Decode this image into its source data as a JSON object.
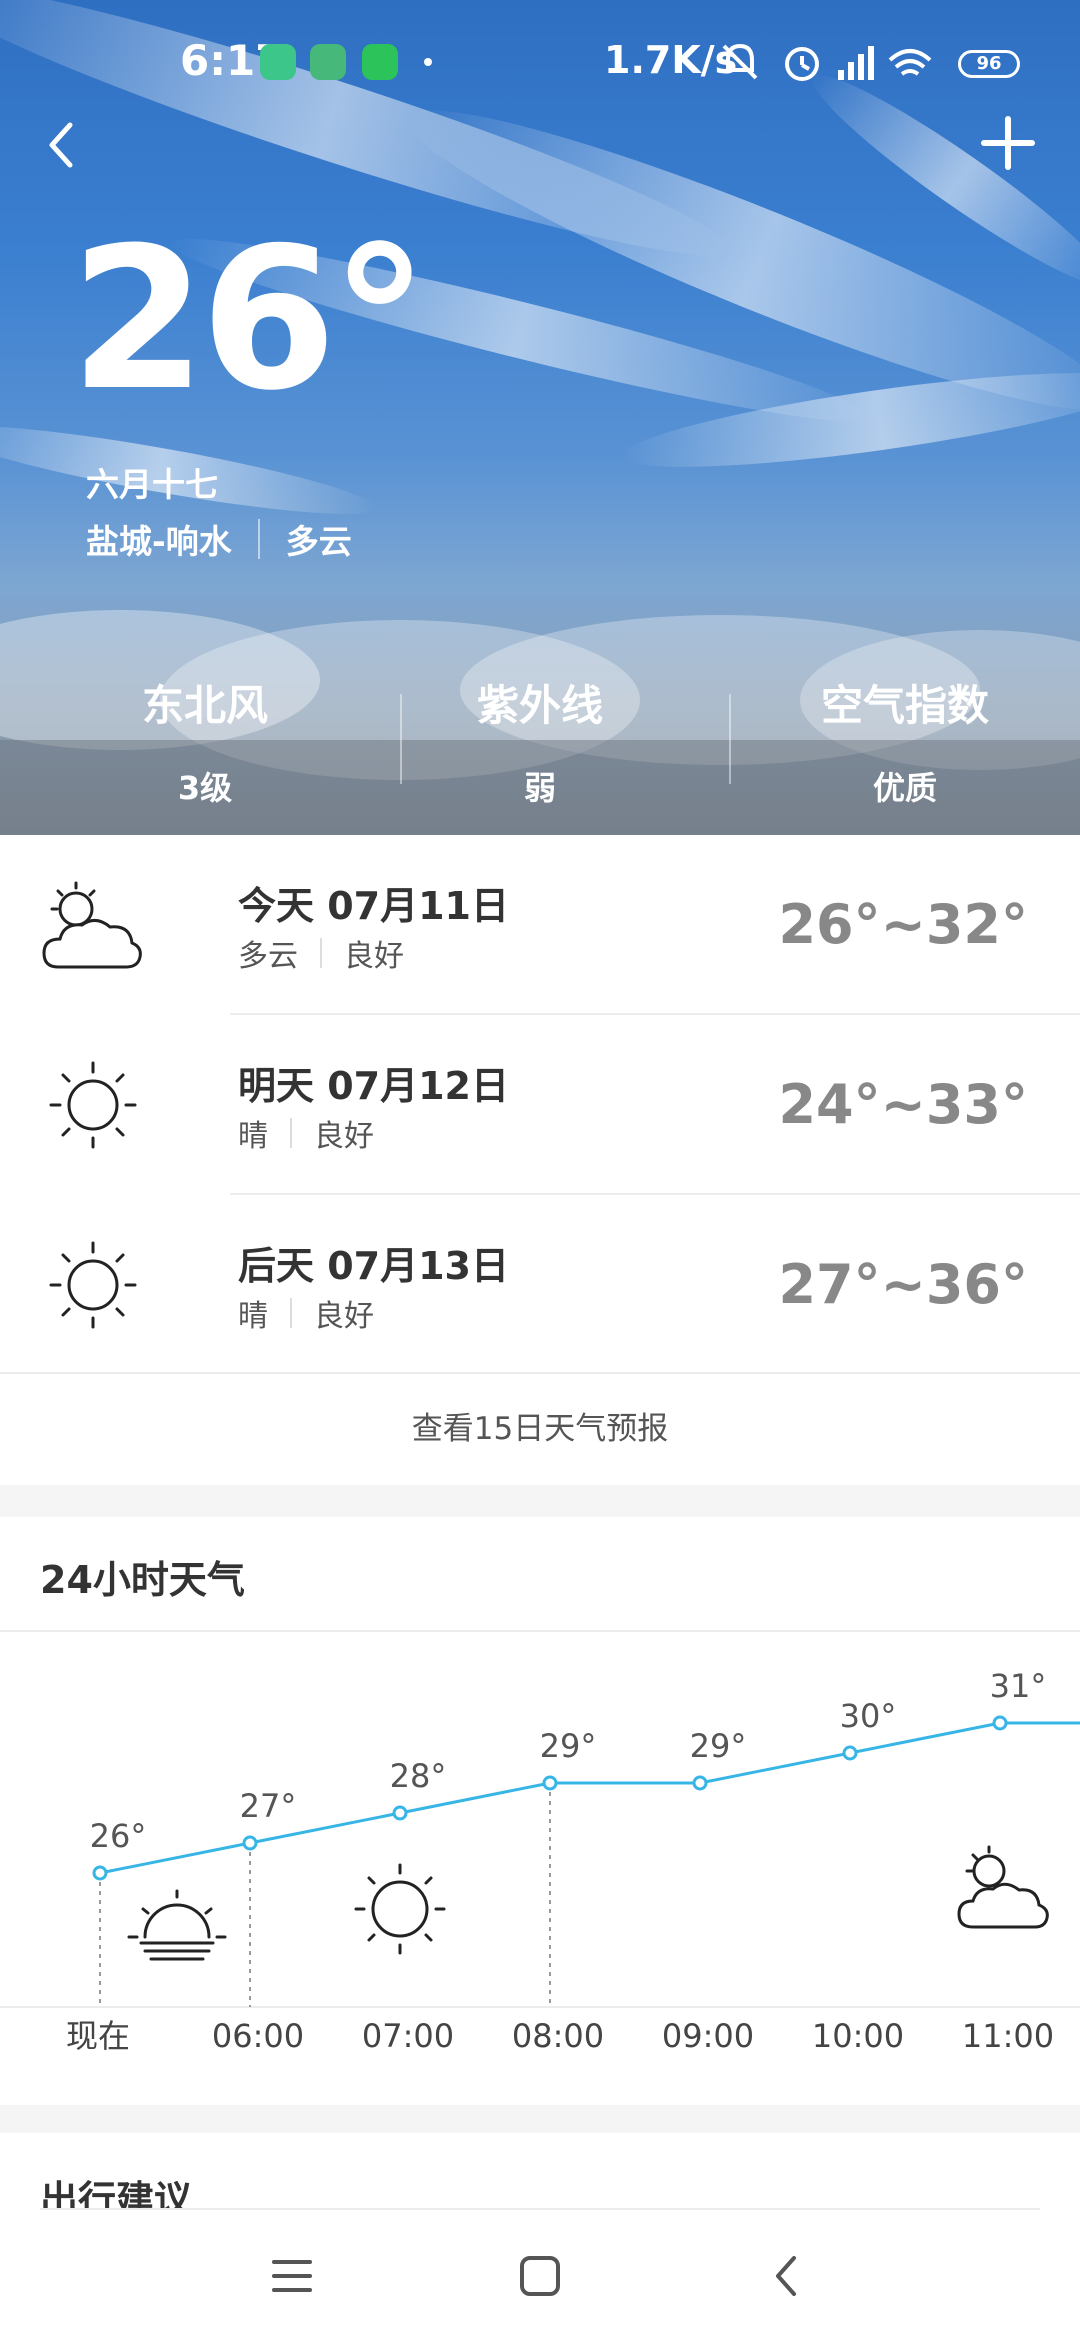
{
  "status_bar": {
    "time": "6:17",
    "network_speed": "1.7K/s",
    "battery": "96"
  },
  "header": {
    "current_temp": "26°",
    "lunar_date": "六月十七",
    "location": "盐城-响水",
    "condition": "多云"
  },
  "metrics": [
    {
      "label": "东北风",
      "value": "3级"
    },
    {
      "label": "紫外线",
      "value": "弱"
    },
    {
      "label": "空气指数",
      "value": "优质"
    }
  ],
  "forecast": {
    "days": [
      {
        "title": "今天 07月11日",
        "condition": "多云",
        "air": "良好",
        "temp": "26°~32°",
        "icon": "partly-cloudy-icon"
      },
      {
        "title": "明天 07月12日",
        "condition": "晴",
        "air": "良好",
        "temp": "24°~33°",
        "icon": "sun-icon"
      },
      {
        "title": "后天 07月13日",
        "condition": "晴",
        "air": "良好",
        "temp": "27°~36°",
        "icon": "sun-icon"
      }
    ],
    "more_link": "查看15日天气预报"
  },
  "hourly": {
    "title": "24小时天气",
    "chart_data": {
      "type": "line",
      "categories": [
        "现在",
        "06:00",
        "07:00",
        "08:00",
        "09:00",
        "10:00",
        "11:00"
      ],
      "series": [
        {
          "values": [
            26,
            27,
            28,
            29,
            29,
            30,
            31
          ]
        }
      ],
      "data_labels": [
        "26°",
        "27°",
        "28°",
        "29°",
        "29°",
        "30°",
        "31°"
      ],
      "icons": [
        "sunrise-icon",
        "sun-icon",
        "partly-cloudy-icon"
      ],
      "line_color": "#37b6e6"
    }
  },
  "advice": {
    "title": "出行建议"
  },
  "colors": {
    "accent": "#37b6e6",
    "text_dark": "#333333",
    "temp_gray": "#888888"
  }
}
